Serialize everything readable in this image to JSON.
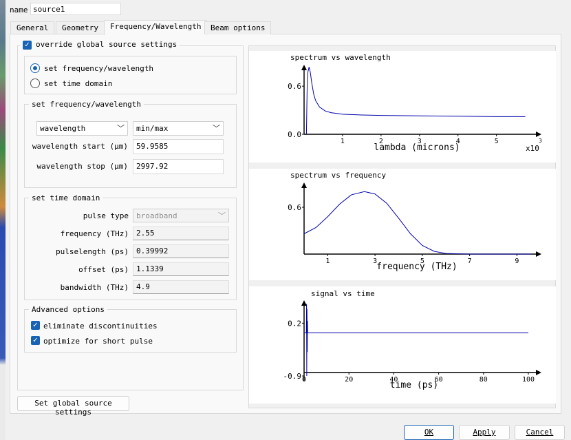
{
  "name": {
    "label": "name",
    "value": "source1"
  },
  "tabs": [
    "General",
    "Geometry",
    "Frequency/Wavelength",
    "Beam options"
  ],
  "active_tab": "Frequency/Wavelength",
  "override": {
    "label": "override global source settings",
    "checked": true
  },
  "mode": {
    "option_fw": "set frequency/wavelength",
    "option_td": "set time domain",
    "selected": "set frequency/wavelength"
  },
  "fw_group": {
    "title": "set frequency/wavelength",
    "type_select": "wavelength",
    "range_select": "min/max",
    "start_label": "wavelength start (μm)",
    "start_value": "59.9585",
    "stop_label": "wavelength stop (μm)",
    "stop_value": "2997.92"
  },
  "td_group": {
    "title": "set time domain",
    "pulse_type_label": "pulse type",
    "pulse_type_value": "broadband",
    "frequency_label": "frequency (THz)",
    "frequency_value": "2.55",
    "pulselength_label": "pulselength (ps)",
    "pulselength_value": "0.39992",
    "offset_label": "offset (ps)",
    "offset_value": "1.1339",
    "bandwidth_label": "bandwidth (THz)",
    "bandwidth_value": "4.9"
  },
  "advanced": {
    "title": "Advanced options",
    "eliminate_label": "eliminate discontinuities",
    "eliminate_checked": true,
    "optimize_label": "optimize for short pulse",
    "optimize_checked": true
  },
  "global_button": "Set global source settings",
  "buttons": {
    "ok": "OK",
    "apply": "Apply",
    "cancel": "Cancel"
  },
  "colors": {
    "accent": "#1a63b3",
    "plot_line": "#0000aa"
  },
  "chart_data": [
    {
      "type": "line",
      "title": "spectrum vs wavelength",
      "xlabel": "lambda (microns)",
      "x_multiplier": "x10",
      "x_multiplier_exp": "3",
      "ylabel": "",
      "xlim": [
        0,
        5.9
      ],
      "ylim": [
        0,
        0.85
      ],
      "xticks": [
        "1",
        "2",
        "3",
        "4",
        "5"
      ],
      "yticks": [
        "0.6",
        "0.0"
      ],
      "series": [
        {
          "x": [
            0.06,
            0.08,
            0.1,
            0.13,
            0.16,
            0.2,
            0.25,
            0.3,
            0.4,
            0.55,
            0.7,
            1.0,
            1.5,
            2.0,
            3.0,
            4.0,
            5.0,
            5.75
          ],
          "y": [
            0.0,
            0.6,
            0.78,
            0.84,
            0.78,
            0.64,
            0.5,
            0.42,
            0.34,
            0.29,
            0.27,
            0.25,
            0.24,
            0.235,
            0.23,
            0.225,
            0.22,
            0.22
          ]
        }
      ]
    },
    {
      "type": "line",
      "title": "spectrum vs frequency",
      "xlabel": "frequency (THz)",
      "ylabel": "",
      "xlim": [
        0,
        9.6
      ],
      "ylim": [
        0,
        0.9
      ],
      "xticks": [
        "1",
        "3",
        "5",
        "7",
        "9"
      ],
      "yticks": [
        "0.6"
      ],
      "series": [
        {
          "x": [
            0.0,
            0.5,
            1.0,
            1.5,
            2.0,
            2.55,
            3.0,
            3.5,
            4.0,
            4.5,
            5.0,
            5.5,
            6.0,
            7.0,
            8.0,
            9.0,
            9.6
          ],
          "y": [
            0.26,
            0.34,
            0.48,
            0.64,
            0.76,
            0.8,
            0.77,
            0.65,
            0.46,
            0.26,
            0.11,
            0.035,
            0.008,
            0.0,
            0.0,
            0.0,
            0.0
          ]
        }
      ]
    },
    {
      "type": "line",
      "title": "signal vs time",
      "xlabel": "time (ps)",
      "ylabel": "",
      "xlim": [
        0,
        100
      ],
      "ylim": [
        -1.0,
        0.65
      ],
      "xticks": [
        "0",
        "20",
        "40",
        "60",
        "80",
        "100"
      ],
      "yticks": [
        "0.2",
        "-0.9"
      ],
      "series": [
        {
          "x": [
            0,
            1.0,
            1.1,
            1.2,
            1.3,
            1.4,
            1.5,
            1.6,
            2,
            100
          ],
          "y": [
            0,
            0,
            0.6,
            -0.9,
            0.5,
            -0.4,
            0.25,
            0.0,
            0.0,
            0.0
          ]
        }
      ]
    }
  ]
}
